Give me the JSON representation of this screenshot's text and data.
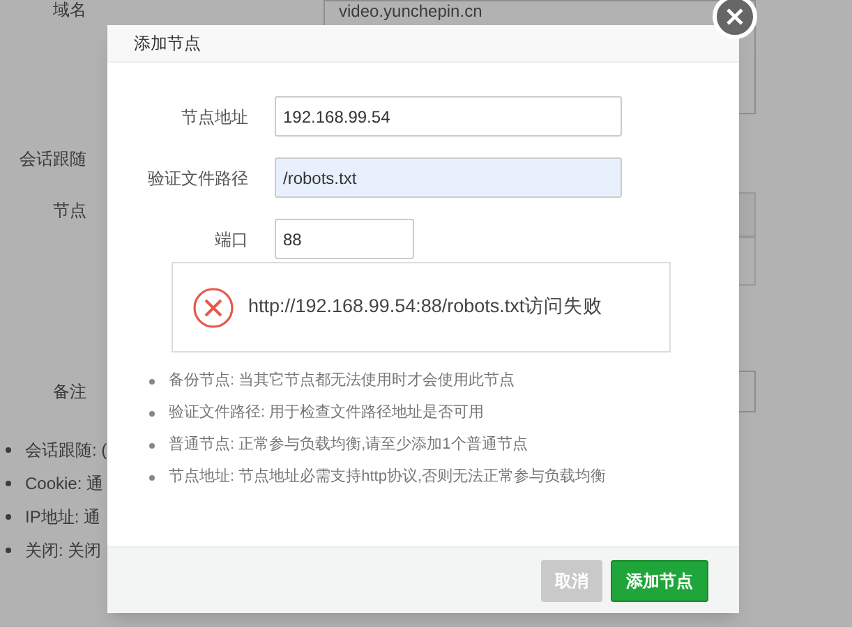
{
  "background": {
    "domain_label": "域名",
    "domain_value": "video.yunchepin.cn",
    "session_label": "会话跟随",
    "node_label": "节点",
    "remark_label": "备注",
    "notes": [
      "会话跟随: (",
      "Cookie: 通",
      "IP地址: 通",
      "关闭: 关闭"
    ]
  },
  "dialog": {
    "title": "添加节点",
    "fields": [
      {
        "label": "节点地址",
        "value": "192.168.99.54",
        "focused": false,
        "wide": true
      },
      {
        "label": "验证文件路径",
        "value": "/robots.txt",
        "focused": true,
        "wide": true
      },
      {
        "label": "端口",
        "value": "88",
        "focused": false,
        "wide": false
      }
    ],
    "error": "http://192.168.99.54:88/robots.txt访问失败",
    "notes": [
      "备份节点: 当其它节点都无法使用时才会使用此节点",
      "验证文件路径: 用于检查文件路径地址是否可用",
      "普通节点: 正常参与负载均衡,请至少添加1个普通节点",
      "节点地址: 节点地址必需支持http协议,否则无法正常参与负载均衡"
    ],
    "buttons": [
      {
        "label": "取消",
        "kind": "secondary"
      },
      {
        "label": "添加节点",
        "kind": "primary"
      }
    ]
  }
}
